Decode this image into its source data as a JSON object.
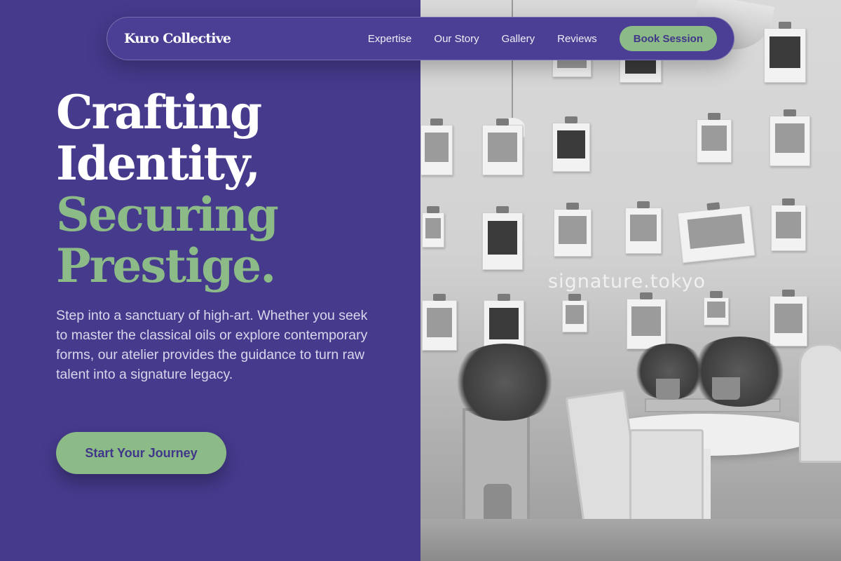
{
  "nav": {
    "brand": "Kuro Collective",
    "links": [
      "Expertise",
      "Our Story",
      "Gallery",
      "Reviews"
    ],
    "cta": "Book Session"
  },
  "hero": {
    "title_lines": [
      "Crafting",
      "Identity,",
      "Securing",
      "Prestige."
    ],
    "description": "Step into a sanctuary of high-art. Whether you seek to master the classical oils or explore contemporary forms, our atelier provides the guidance to turn raw talent into a signature legacy.",
    "cta": "Start Your Journey"
  },
  "image": {
    "watermark": "signature.tokyo"
  },
  "colors": {
    "primary": "#453a8c",
    "accent": "#8dbb87",
    "text_light": "#ffffff"
  }
}
